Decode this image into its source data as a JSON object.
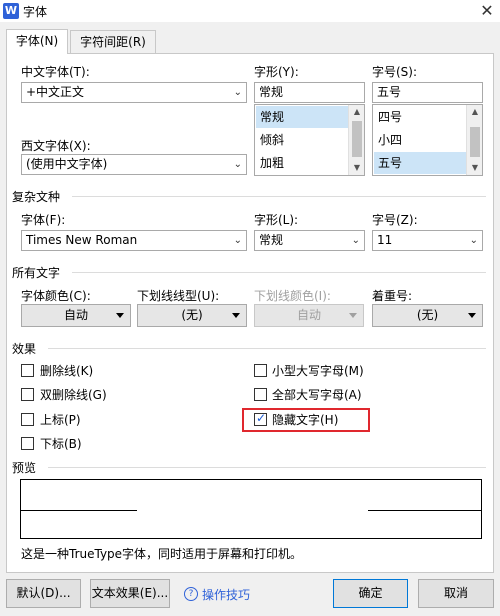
{
  "window": {
    "app_icon_letter": "W",
    "title": "字体",
    "close_glyph": "✕"
  },
  "tabs": [
    {
      "label": "字体(N)"
    },
    {
      "label": "字符间距(R)"
    }
  ],
  "cjk_font": {
    "label": "中文字体(T):",
    "value": "+中文正文"
  },
  "style": {
    "label": "字形(Y):",
    "value": "常规",
    "options": [
      "常规",
      "倾斜",
      "加粗"
    ]
  },
  "size": {
    "label": "字号(S):",
    "value": "五号",
    "options": [
      "四号",
      "小四",
      "五号"
    ]
  },
  "western_font": {
    "label": "西文字体(X):",
    "value": "(使用中文字体)"
  },
  "complex": {
    "section": "复杂文种",
    "font_label": "字体(F):",
    "font_value": "Times New Roman",
    "style_label": "字形(L):",
    "style_value": "常规",
    "size_label": "字号(Z):",
    "size_value": "11"
  },
  "all_text": {
    "section": "所有文字",
    "color_label": "字体颜色(C):",
    "color_value": "自动",
    "underline_label": "下划线线型(U):",
    "underline_value": "(无)",
    "underline_color_label": "下划线颜色(I):",
    "underline_color_value": "自动",
    "emphasis_label": "着重号:",
    "emphasis_value": "(无)"
  },
  "effects": {
    "section": "效果",
    "strikethrough": "删除线(K)",
    "double_strikethrough": "双删除线(G)",
    "superscript": "上标(P)",
    "subscript": "下标(B)",
    "small_caps": "小型大写字母(M)",
    "all_caps": "全部大写字母(A)",
    "hidden": "隐藏文字(H)",
    "hidden_checked": true
  },
  "preview": {
    "section": "预览",
    "note": "这是一种TrueType字体，同时适用于屏幕和打印机。"
  },
  "buttons": {
    "default": "默认(D)...",
    "text_effects": "文本效果(E)...",
    "tips": "操作技巧",
    "ok": "确定",
    "cancel": "取消"
  }
}
